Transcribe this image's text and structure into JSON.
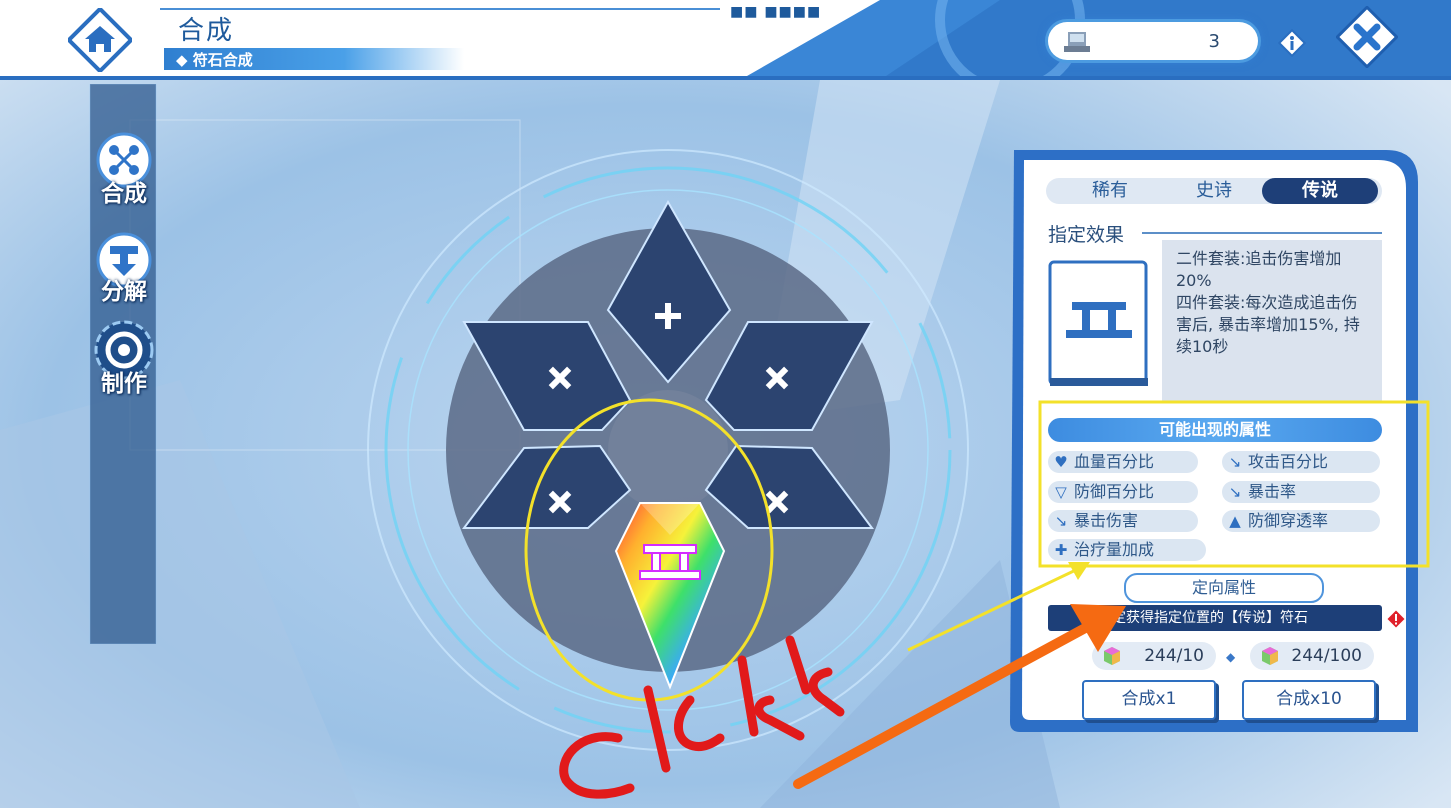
{
  "header": {
    "title": "合成",
    "subtitle": "符石合成",
    "resource_count": "3",
    "home_icon": "home-icon",
    "close_icon": "close-icon",
    "info_icon": "info-icon"
  },
  "sidebar": {
    "items": [
      {
        "label": "合成",
        "icon": "synthesis-icon"
      },
      {
        "label": "分解",
        "icon": "decompose-icon"
      },
      {
        "label": "制作",
        "icon": "craft-gear-icon"
      }
    ]
  },
  "rarity_tabs": [
    "稀有",
    "史诗",
    "传说"
  ],
  "active_tab": "传说",
  "effect": {
    "title": "指定效果",
    "lines": [
      "二件套装:追击伤害增加",
      "20%",
      "四件套装:每次造成追击伤",
      "害后, 暴击率增加15%, 持",
      "续10秒"
    ]
  },
  "attributes": {
    "header": "可能出现的属性",
    "items": [
      {
        "label": "血量百分比",
        "icon": "heart-icon"
      },
      {
        "label": "攻击百分比",
        "icon": "sword-icon"
      },
      {
        "label": "防御百分比",
        "icon": "shield-icon"
      },
      {
        "label": "暴击率",
        "icon": "crit-arrow-icon"
      },
      {
        "label": "暴击伤害",
        "icon": "crit-damage-icon"
      },
      {
        "label": "防御穿透率",
        "icon": "penetration-icon"
      },
      {
        "label": "治疗量加成",
        "icon": "plus-heal-icon"
      }
    ]
  },
  "directed_button": "定向属性",
  "warning": "定获得指定位置的【传说】符石",
  "costs": [
    "244/10",
    "244/100"
  ],
  "buttons": {
    "craft1": "合成x1",
    "craft10": "合成x10"
  },
  "annotation_text": "click",
  "colors": {
    "annotation_yellow": "#f3e12a",
    "annotation_orange": "#f56a12",
    "annotation_red": "#e11a1a",
    "accent": "#2f7fd0"
  }
}
